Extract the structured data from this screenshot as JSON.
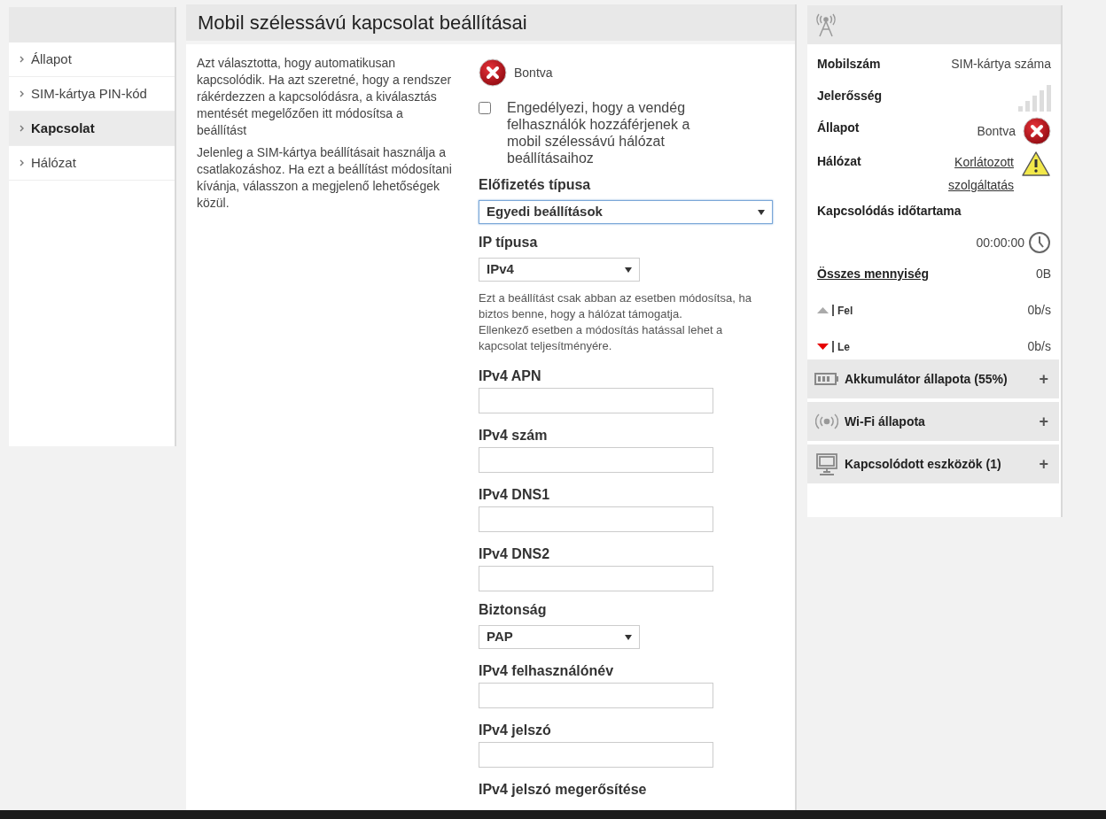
{
  "sidebar": {
    "items": [
      {
        "label": "Állapot",
        "selected": false
      },
      {
        "label": "SIM-kártya PIN-kód",
        "selected": false
      },
      {
        "label": "Kapcsolat",
        "selected": true
      },
      {
        "label": "Hálózat",
        "selected": false
      }
    ]
  },
  "main": {
    "title": "Mobil szélessávú kapcsolat beállításai",
    "description": [
      "Azt választotta, hogy automatikusan kapcsolódik. Ha azt szeretné, hogy a rendszer rákérdezzen a kapcsolódásra, a kiválasztás mentését megelőzően itt módosítsa a beállítást",
      "Jelenleg a SIM-kártya beállításait használja a csatlakozáshoz. Ha ezt a beállítást módosítani kívánja, válasszon a megjelenő lehetőségek közül."
    ],
    "status": "Bontva",
    "guest_access": {
      "label": "Engedélyezi, hogy a vendég felhasználók hozzáférjenek a mobil szélessávú hálózat beállításaihoz",
      "checked": false
    },
    "fields": [
      {
        "kind": "select",
        "label": "Előfizetés típusa",
        "value": "Egyedi beállítások",
        "wide": true,
        "focused": true
      },
      {
        "kind": "select",
        "label": "IP típusa",
        "value": "IPv4",
        "wide": false,
        "focused": false
      },
      {
        "kind": "note",
        "text": "Ezt a beállítást csak abban az esetben módosítsa, ha biztos benne, hogy a hálózat támogatja.\nEllenkező esetben a módosítás hatással lehet a kapcsolat teljesítményére."
      },
      {
        "kind": "text",
        "label": "IPv4 APN"
      },
      {
        "kind": "text",
        "label": "IPv4 szám"
      },
      {
        "kind": "text",
        "label": "IPv4 DNS1"
      },
      {
        "kind": "text",
        "label": "IPv4 DNS2"
      },
      {
        "kind": "select",
        "label": "Biztonság",
        "value": "PAP",
        "wide": false,
        "focused": false
      },
      {
        "kind": "text",
        "label": "IPv4 felhasználónév"
      },
      {
        "kind": "text",
        "label": "IPv4 jelszó"
      },
      {
        "kind": "heading",
        "label": "IPv4 jelszó megerősítése"
      }
    ]
  },
  "status_panel": {
    "rows": [
      {
        "kind": "text",
        "label": "Mobilszám",
        "value": "SIM-kártya száma"
      },
      {
        "kind": "signal",
        "label": "Jelerősség"
      },
      {
        "kind": "error",
        "label": "Állapot",
        "value": "Bontva"
      },
      {
        "kind": "warning",
        "label": "Hálózat",
        "value": "Korlátozott szolgáltatás"
      }
    ],
    "duration": {
      "label": "Kapcsolódás időtartama",
      "value": "00:00:00"
    },
    "total": {
      "label": "Összes mennyiség",
      "value": "0B"
    },
    "traffic": [
      {
        "kind": "up",
        "label": "Fel",
        "value": "0b/s"
      },
      {
        "kind": "down",
        "label": "Le",
        "value": "0b/s"
      }
    ],
    "sections": [
      {
        "kind": "battery",
        "label": "Akkumulátor állapota (55%)",
        "toggle": "+"
      },
      {
        "kind": "wifi",
        "label": "Wi-Fi állapota",
        "toggle": "+"
      },
      {
        "kind": "devices",
        "label": "Kapcsolódott eszközök (1)",
        "toggle": "+"
      }
    ]
  }
}
